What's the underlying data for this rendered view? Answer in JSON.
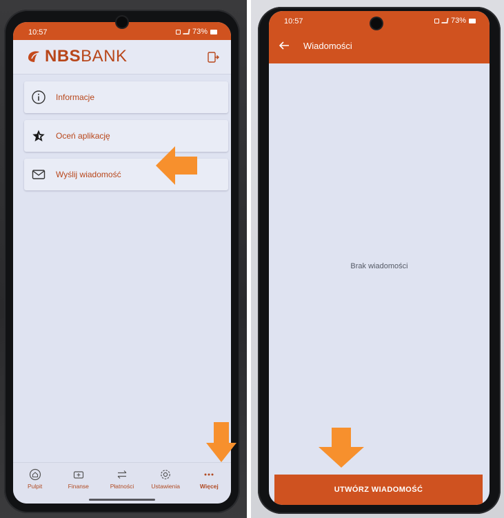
{
  "left_screen": {
    "status_bar": {
      "time": "10:57",
      "battery": "73%"
    },
    "header": {
      "logo_bold": "NBS",
      "logo_light": "BANK",
      "logout_icon": "logout-icon"
    },
    "menu": [
      {
        "label": "Informacje",
        "icon": "info-icon"
      },
      {
        "label": "Oceń aplikację",
        "icon": "star-icon"
      },
      {
        "label": "Wyślij wiadomość",
        "icon": "envelope-icon"
      }
    ],
    "bottom_nav": [
      {
        "label": "Pulpit",
        "icon": "home-icon"
      },
      {
        "label": "Finanse",
        "icon": "wallet-icon"
      },
      {
        "label": "Płatności",
        "icon": "transfer-icon"
      },
      {
        "label": "Ustawienia",
        "icon": "gear-icon"
      },
      {
        "label": "Więcej",
        "icon": "more-icon",
        "active": true
      }
    ]
  },
  "right_screen": {
    "status_bar": {
      "time": "10:57",
      "battery": "73%"
    },
    "toolbar": {
      "title": "Wiadomości",
      "back_icon": "back-arrow-icon"
    },
    "empty_state": "Brak wiadomości",
    "compose_button": "UTWÓRZ WIADOMOŚĆ"
  },
  "colors": {
    "brand": "#d0521f",
    "screen_bg": "#dfe3f1",
    "annotation_arrow": "#f7902d"
  }
}
